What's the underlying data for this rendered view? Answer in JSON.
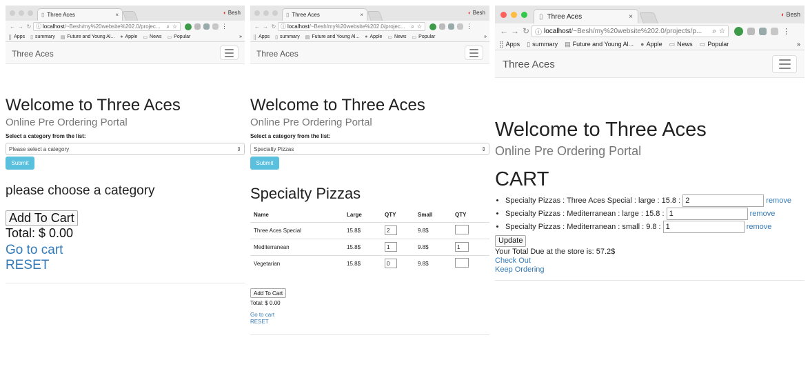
{
  "browser": {
    "tab_title": "Three Aces",
    "profile_name": "Besh",
    "url_host": "localhost",
    "url_path_short": "/~Besh/my%20website%202.0/projec...",
    "url_path_long": "/~Besh/my%20website%202.0/projects/p...",
    "bookmarks": [
      "Apps",
      "summary",
      "Future and Young Al...",
      "Apple",
      "News",
      "Popular"
    ],
    "bookmarks_more": "»",
    "extension_off_label": "OFF"
  },
  "site": {
    "brand": "Three Aces",
    "welcome": "Welcome to Three Aces",
    "subtitle": "Online Pre Ordering Portal"
  },
  "panel1": {
    "select_label": "Select a category from the list:",
    "select_value": "Please select a category",
    "submit": "Submit",
    "message": "please choose a category",
    "add_to_cart": "Add To Cart",
    "total": "Total: $ 0.00",
    "go_to_cart": "Go to cart",
    "reset": "RESET"
  },
  "panel2": {
    "select_label": "Select a category from the list:",
    "select_value": "Specialty Pizzas",
    "submit": "Submit",
    "heading": "Specialty Pizzas",
    "columns": [
      "Name",
      "Large",
      "QTY",
      "Small",
      "QTY"
    ],
    "rows": [
      {
        "name": "Three Aces Special",
        "large": "15.8$",
        "large_qty": "2",
        "small": "9.8$",
        "small_qty": ""
      },
      {
        "name": "Mediterranean",
        "large": "15.8$",
        "large_qty": "1",
        "small": "9.8$",
        "small_qty": "1"
      },
      {
        "name": "Vegetarian",
        "large": "15.8$",
        "large_qty": "0",
        "small": "9.8$",
        "small_qty": ""
      }
    ],
    "add_to_cart": "Add To Cart",
    "total": "Total: $ 0.00",
    "go_to_cart": "Go to cart",
    "reset": "RESET"
  },
  "panel3": {
    "heading": "CART",
    "items": [
      {
        "text": "Specialty Pizzas : Three Aces Special : large : 15.8 :",
        "qty": "2",
        "remove": "remove"
      },
      {
        "text": "Specialty Pizzas : Mediterranean : large : 15.8 :",
        "qty": "1",
        "remove": "remove"
      },
      {
        "text": "Specialty Pizzas : Mediterranean : small : 9.8 :",
        "qty": "1",
        "remove": "remove"
      }
    ],
    "update": "Update",
    "total_due": "Your Total Due at the store is: 57.2$",
    "check_out": "Check Out",
    "keep_ordering": "Keep Ordering"
  },
  "colors": {
    "link": "#337ab7",
    "info_button": "#5bc0de",
    "mac_close": "#fc605c",
    "mac_min": "#fdbc40",
    "mac_max": "#34c84a"
  }
}
